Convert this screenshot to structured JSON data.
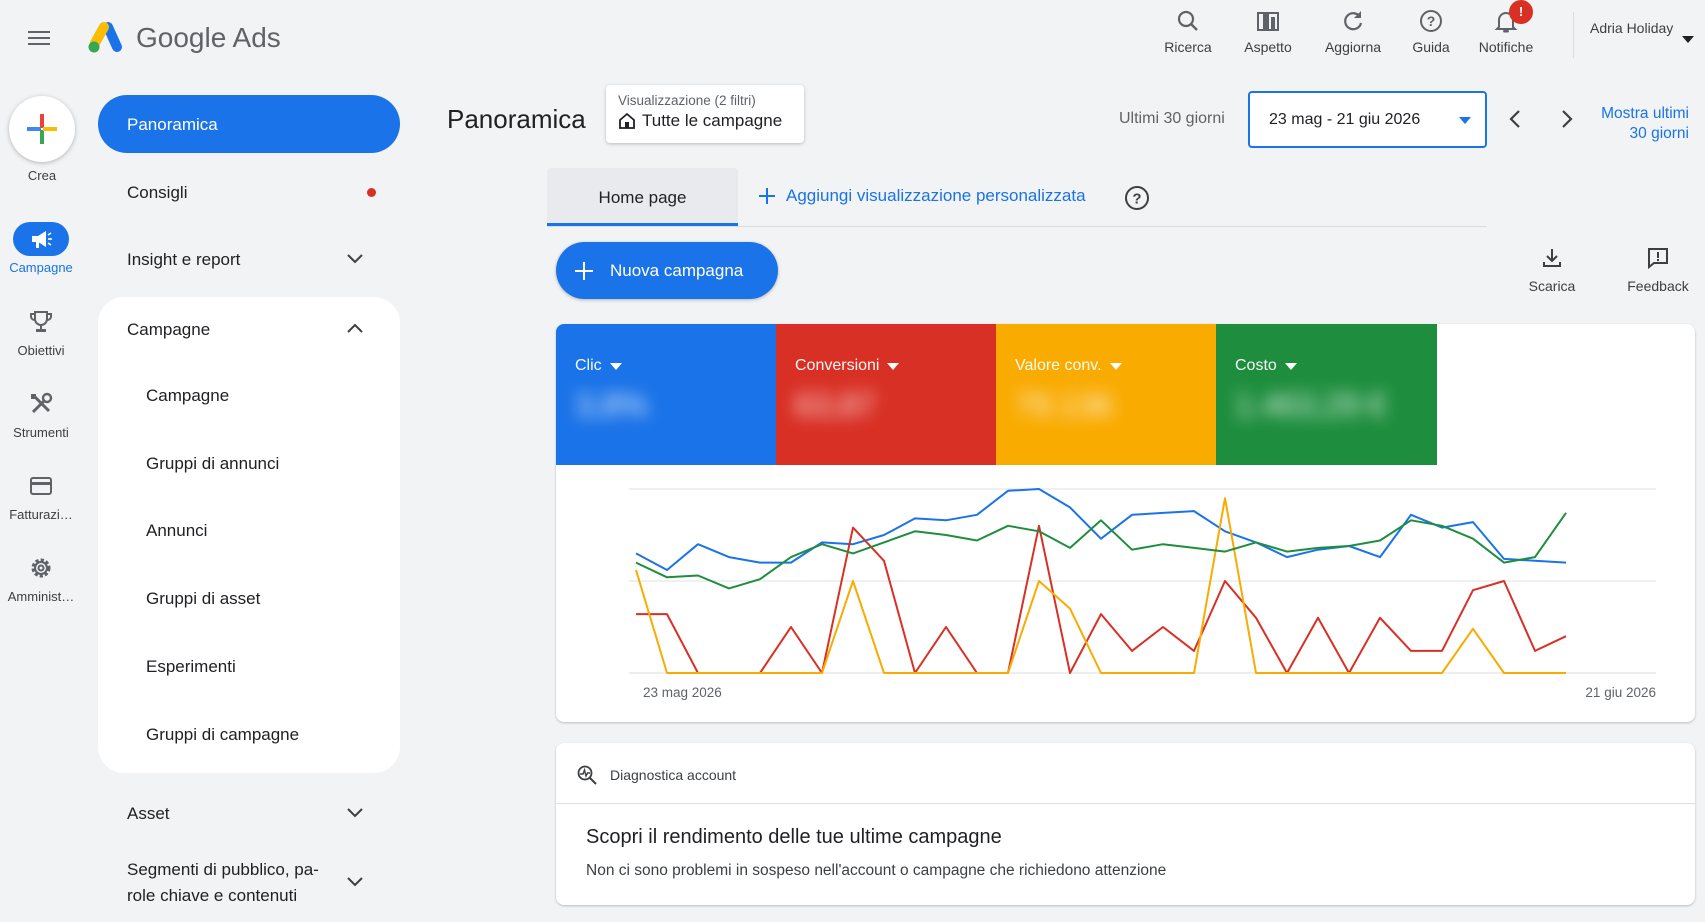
{
  "app": {
    "brand": "Google Ads"
  },
  "topbar": {
    "buttons": [
      {
        "id": "ricerca",
        "label": "Ricerca",
        "icon": "search-icon"
      },
      {
        "id": "aspetto",
        "label": "Aspetto",
        "icon": "appearance-icon"
      },
      {
        "id": "aggiorna",
        "label": "Aggiorna",
        "icon": "refresh-icon"
      },
      {
        "id": "guida",
        "label": "Guida",
        "icon": "help-icon"
      },
      {
        "id": "notifiche",
        "label": "Notifiche",
        "icon": "bell-icon"
      }
    ],
    "notification_badge": "!",
    "user_name": "Adria Holiday"
  },
  "rail": {
    "crea": "Crea",
    "items": [
      {
        "label": "Campagne",
        "icon": "megaphone-icon",
        "active": true
      },
      {
        "label": "Obiettivi",
        "icon": "trophy-icon",
        "active": false
      },
      {
        "label": "Strumenti",
        "icon": "tools-icon",
        "active": false
      },
      {
        "label": "Fatturazi…",
        "icon": "credit-card-icon",
        "active": false
      },
      {
        "label": "Amminist…",
        "icon": "gear-icon",
        "active": false
      }
    ]
  },
  "nav": {
    "active": "Panoramica",
    "consigli": "Consigli",
    "insight": "Insight e report",
    "campagne_group": "Campagne",
    "sub_items": [
      "Campagne",
      "Gruppi di annunci",
      "Annunci",
      "Gruppi di asset",
      "Esperimenti",
      "Gruppi di campagne"
    ],
    "asset": "Asset",
    "segmenti": "Segmenti di pubblico, pa-role chiave e contenuti"
  },
  "header": {
    "title": "Panoramica",
    "view_small": "Visualizzazione (2 filtri)",
    "view_main": "Tutte le campagne",
    "range_label": "Ultimi 30 giorni",
    "date_range": "23 mag - 21 giu 2026",
    "show_last": "Mostra ultimi 30 giorni"
  },
  "tabs": {
    "home": "Home page",
    "add": "Aggiungi visualizzazione personalizzata"
  },
  "actions": {
    "new_campaign": "Nuova campagna",
    "download": "Scarica",
    "feedback": "Feedback"
  },
  "scorecards": [
    {
      "name": "Clic",
      "value": "3,8%",
      "color": "#1a73e8"
    },
    {
      "name": "Conversioni",
      "value": "63,87",
      "color": "#d93025"
    },
    {
      "name": "Valore conv.",
      "value": "79.136",
      "color": "#f9ab00"
    },
    {
      "name": "Costo",
      "value": "1.463,29 €",
      "color": "#1e8e3e"
    }
  ],
  "chart_data": {
    "type": "line",
    "x_start_label": "23 mag 2026",
    "x_end_label": "21 giu 2026",
    "ylim": [
      0,
      100
    ],
    "grid": true,
    "series": [
      {
        "name": "Clic",
        "color": "#1a73e8",
        "values": [
          65,
          56,
          70,
          63,
          60,
          60,
          71,
          70,
          75,
          84,
          83,
          86,
          99,
          100,
          90,
          73,
          86,
          87,
          88,
          77,
          71,
          63,
          67,
          69,
          63,
          86,
          79,
          82,
          62,
          61,
          60
        ]
      },
      {
        "name": "Conversioni",
        "color": "#d93025",
        "values": [
          32,
          32,
          0,
          0,
          0,
          25,
          0,
          79,
          61,
          0,
          25,
          0,
          0,
          80,
          0,
          32,
          12,
          25,
          12,
          50,
          30,
          0,
          30,
          0,
          30,
          12,
          12,
          45,
          50,
          12,
          20
        ]
      },
      {
        "name": "Valore conv.",
        "color": "#f9ab00",
        "values": [
          56,
          0,
          0,
          0,
          0,
          0,
          0,
          50,
          0,
          0,
          0,
          0,
          0,
          50,
          35,
          0,
          0,
          0,
          0,
          95,
          0,
          0,
          0,
          0,
          0,
          0,
          0,
          24,
          0,
          0,
          0
        ]
      },
      {
        "name": "Costo",
        "color": "#1e8e3e",
        "values": [
          60,
          52,
          53,
          46,
          51,
          63,
          70,
          65,
          71,
          77,
          75,
          72,
          80,
          77,
          68,
          83,
          67,
          70,
          68,
          66,
          71,
          66,
          68,
          69,
          72,
          83,
          80,
          73,
          60,
          63,
          87
        ]
      }
    ]
  },
  "diagnostics": {
    "head": "Diagnostica account",
    "title": "Scopri il rendimento delle tue ultime campagne",
    "desc": "Non ci sono problemi in sospeso nell'account o campagne che richiedono attenzione"
  }
}
